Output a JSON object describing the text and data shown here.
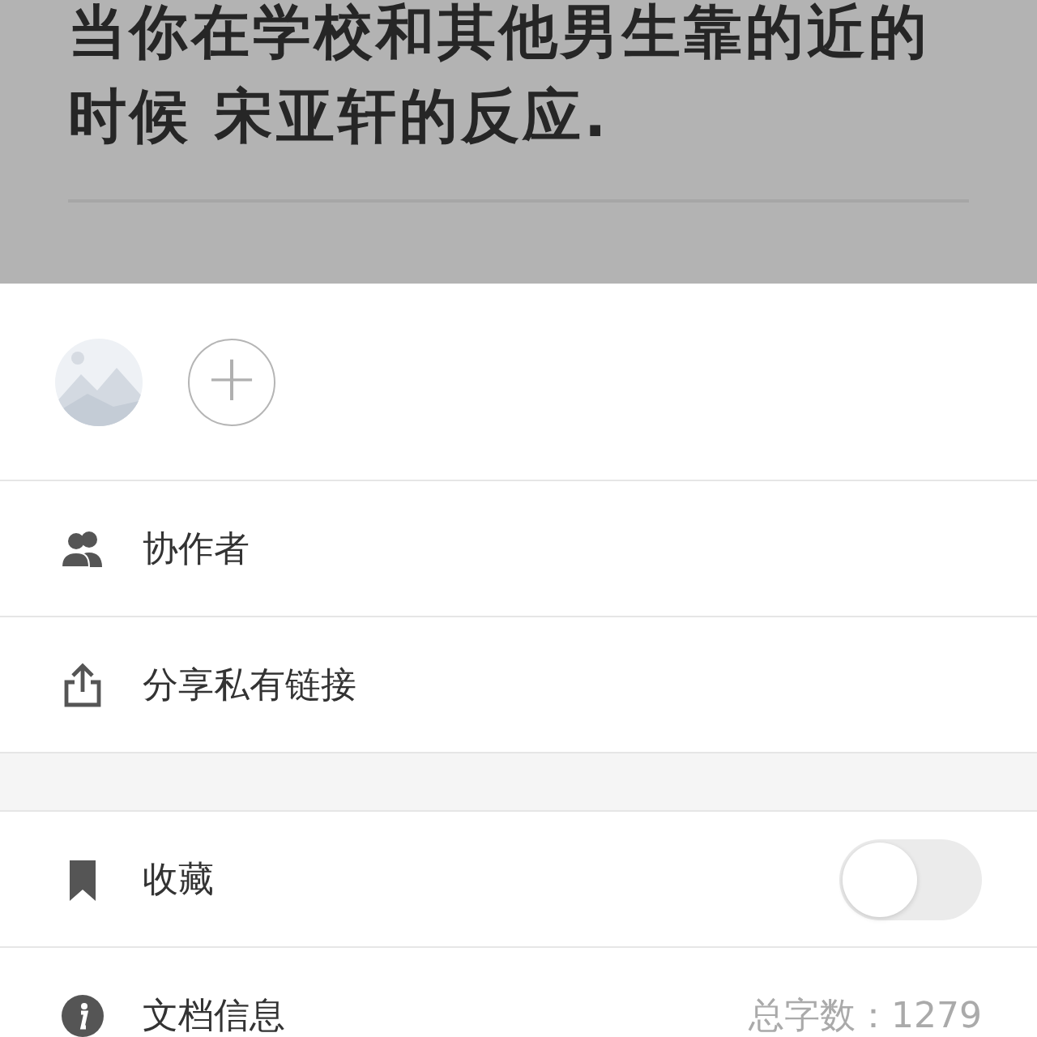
{
  "backdrop": {
    "title": "当你在学校和其他男生靠的近的时候 宋亚轩的反应."
  },
  "sheet": {
    "add_button": {
      "label": "+"
    },
    "groups": [
      {
        "rows": [
          {
            "kind": "people",
            "label": "协作者"
          },
          {
            "kind": "share",
            "label": "分享私有链接"
          }
        ]
      },
      {
        "rows": [
          {
            "kind": "bookmark",
            "label": "收藏",
            "toggle": {
              "on": false
            }
          },
          {
            "kind": "info",
            "label": "文档信息",
            "value": "总字数：1279"
          }
        ]
      }
    ]
  }
}
